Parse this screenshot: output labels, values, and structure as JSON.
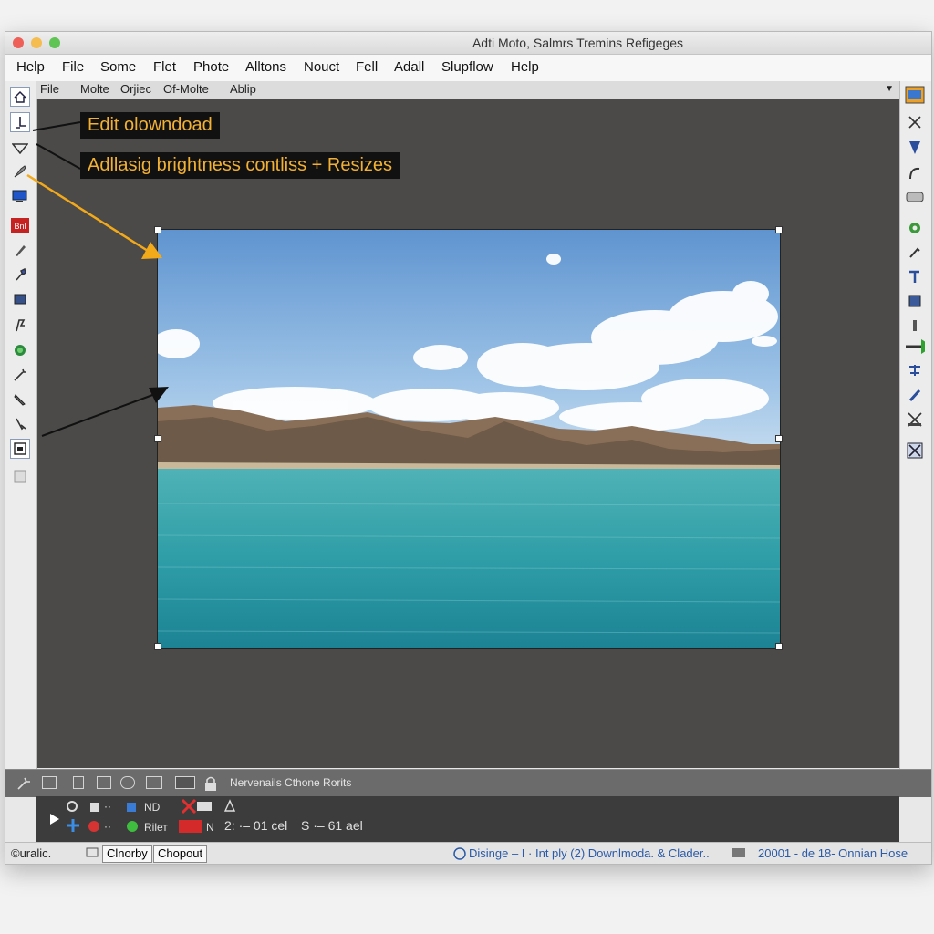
{
  "window": {
    "title": "Adti Moto, Salmrs Tremins Refigeges"
  },
  "menu": [
    "Help",
    "File",
    "Some",
    "Flet",
    "Phote",
    "Alltons",
    "Nouct",
    "Fell",
    "Adall",
    "Slupflow",
    "Help"
  ],
  "submenu": [
    "File",
    "Molte",
    "Orjiec",
    "Of-Molte",
    "Ablip"
  ],
  "callouts": {
    "edit": "Edit olowndoad",
    "adjust": "Adllasig brightness contliss + Resizes"
  },
  "left_tools": [
    "home-icon",
    "pen-icon",
    "shape-icon",
    "brush-icon",
    "screen-icon",
    "badge-icon",
    "pencil-icon",
    "eyedropper-icon",
    "layer-icon",
    "pen-tool-icon",
    "globe-icon",
    "wand-icon",
    "knife-icon",
    "needle-icon",
    "frame-icon",
    "square-icon"
  ],
  "left_badge": "Bnl",
  "right_tools": [
    "image-icon",
    "crosshair-icon",
    "select-icon",
    "curve-icon",
    "rect-icon",
    "gear-icon",
    "pipette-icon",
    "hammer-icon",
    "layers-icon",
    "bolt-icon",
    "arrow-right-icon",
    "gears-icon",
    "brush2-icon",
    "transform-icon",
    "filter-icon"
  ],
  "panel": {
    "title": "Nervenails Cthone Rorits",
    "row1": {
      "a": "ND"
    },
    "row2": {
      "a": "Rilет",
      "b": "N",
      "c": "2: ·– 01 cel",
      "d": "S ·– 61 ael",
      "e": "»»",
      "f": "··"
    },
    "row1_extra": "··"
  },
  "status": {
    "left": "©uralic.",
    "btn1": "Clnorby",
    "btn2": "Chopout",
    "middle": "Disinge – I · Int ply (2) Downlmoda. & Clader..",
    "right": "20001 - de 18- Onnian Hose"
  },
  "colors": {
    "accent": "#f2b134",
    "canvas": "#4b4a48",
    "panel": "#3c3c3c"
  }
}
